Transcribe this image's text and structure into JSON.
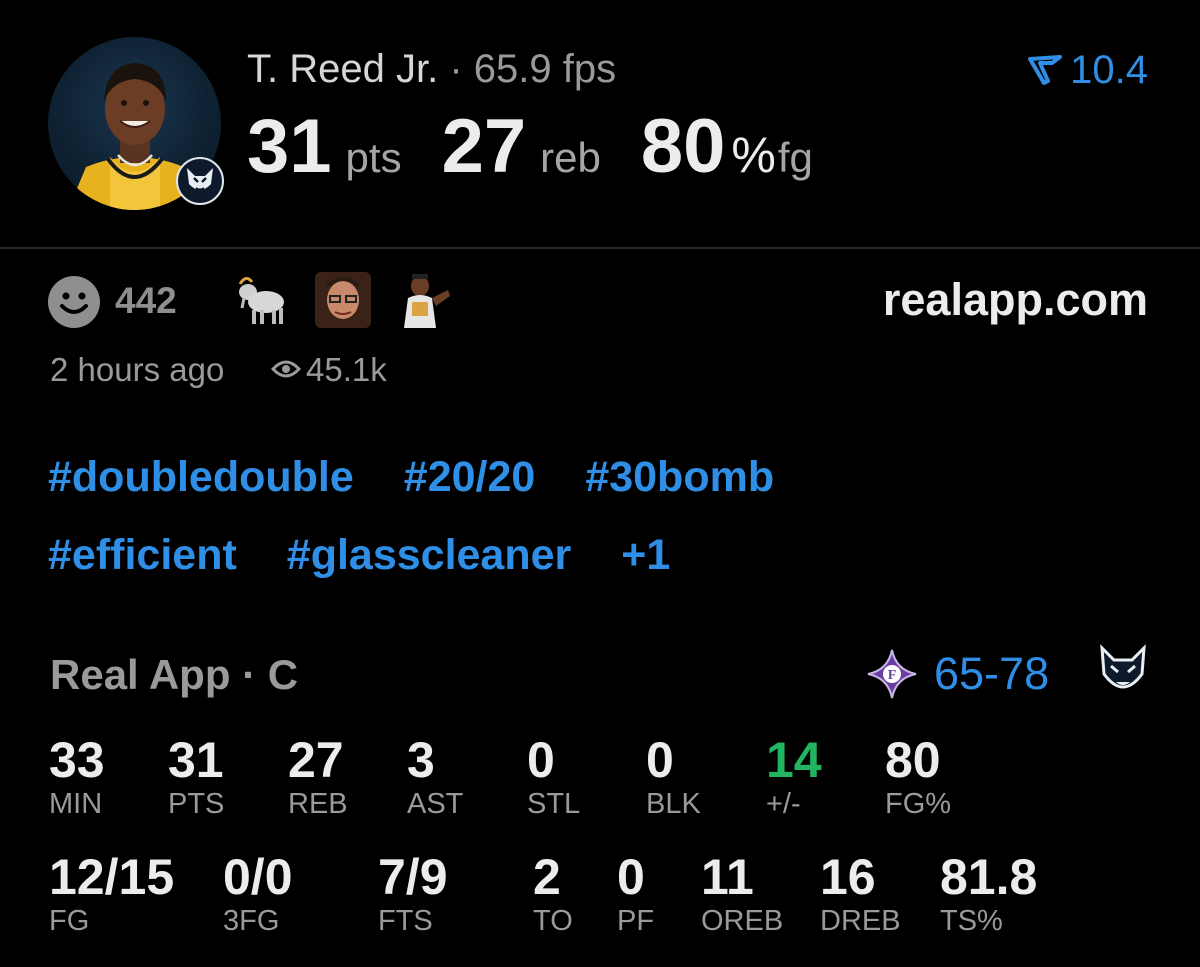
{
  "player": {
    "name": "T. Reed Jr.",
    "separator": "·",
    "fps": "65.9 fps",
    "rating": "10.4",
    "rating_icon": "real-v-icon",
    "headline": [
      {
        "value": "31",
        "unit": "pts"
      },
      {
        "value": "27",
        "unit": "reb"
      },
      {
        "value": "80",
        "unit": "fg",
        "pct": "%"
      }
    ]
  },
  "post": {
    "reaction_count": "442",
    "reaction_icons": [
      "smiley-icon",
      "goat-emoji",
      "face-emoji",
      "player-emoji"
    ],
    "site": "realapp.com",
    "time": "2 hours ago",
    "views": "45.1k",
    "tags_row1": [
      "#doubledouble",
      "#20/20",
      "#30bomb"
    ],
    "tags_row2": [
      "#efficient",
      "#glasscleaner",
      "+1"
    ]
  },
  "game": {
    "league": "Real App · C",
    "score": "65-78",
    "opponent_logo": "furman-logo",
    "home_logo": "uconn-husky-logo"
  },
  "stats_row1": [
    {
      "value": "33",
      "label": "MIN"
    },
    {
      "value": "31",
      "label": "PTS"
    },
    {
      "value": "27",
      "label": "REB"
    },
    {
      "value": "3",
      "label": "AST"
    },
    {
      "value": "0",
      "label": "STL"
    },
    {
      "value": "0",
      "label": "BLK"
    },
    {
      "value": "14",
      "label": "+/-"
    },
    {
      "value": "80",
      "label": "FG%"
    }
  ],
  "stats_row2": [
    {
      "value": "12/15",
      "label": "FG"
    },
    {
      "value": "0/0",
      "label": "3FG"
    },
    {
      "value": "7/9",
      "label": "FTS"
    },
    {
      "value": "2",
      "label": "TO"
    },
    {
      "value": "0",
      "label": "PF"
    },
    {
      "value": "11",
      "label": "OREB"
    },
    {
      "value": "16",
      "label": "DREB"
    },
    {
      "value": "81.8",
      "label": "TS%"
    }
  ],
  "colors": {
    "accent_blue": "#2f8fe6",
    "positive_green": "#22b561",
    "muted": "#9a9a9a",
    "background": "#000000"
  }
}
